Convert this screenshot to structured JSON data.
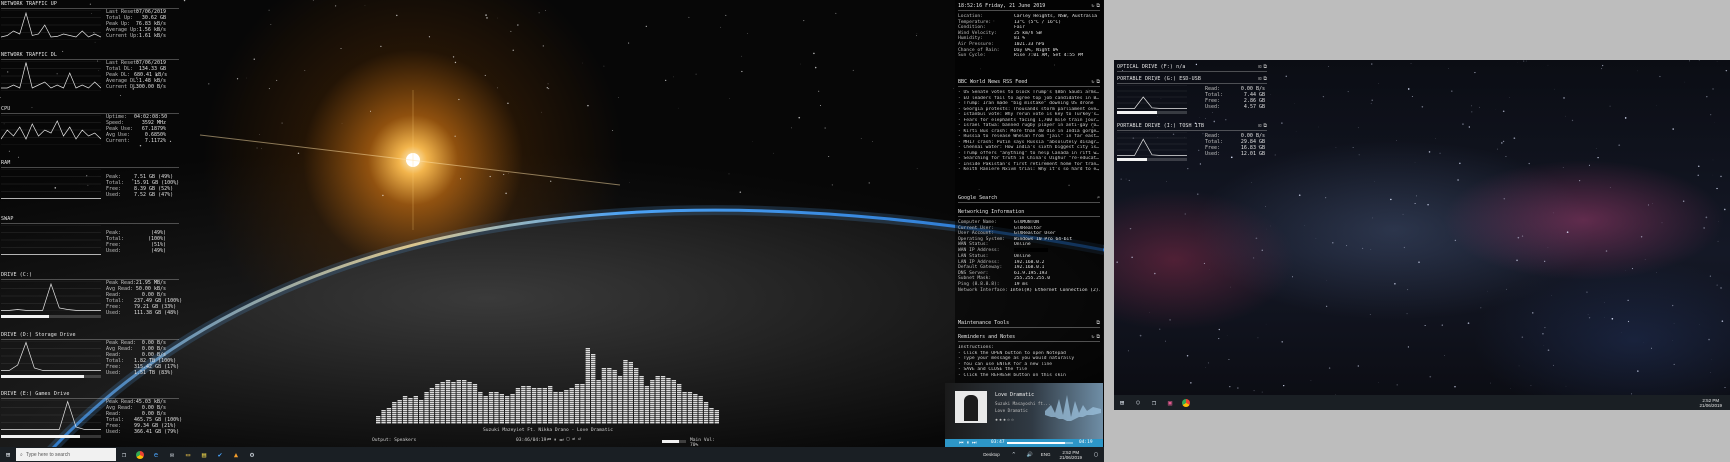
{
  "left_widgets": {
    "net_up": {
      "title": "NETWORK TRAFFIC UP",
      "rows": [
        {
          "label": "Last Reset:",
          "value": "07/06/2019"
        },
        {
          "label": "Total Up:",
          "value": "30.62 GB"
        },
        {
          "label": "Peak Up:",
          "value": "76.83 kB/s"
        },
        {
          "label": "Average Up:",
          "value": "1.56 kB/s"
        },
        {
          "label": "Current Up:",
          "value": "1.61 kB/s"
        }
      ]
    },
    "net_dl": {
      "title": "NETWORK TRAFFIC DL",
      "rows": [
        {
          "label": "Last Reset:",
          "value": "07/06/2019"
        },
        {
          "label": "Total DL:",
          "value": "134.33 GB"
        },
        {
          "label": "Peak DL:",
          "value": "680.41 kB/s"
        },
        {
          "label": "Average DL:",
          "value": "1.48 kB/s"
        },
        {
          "label": "Current DL:",
          "value": "300.00 B/s"
        }
      ]
    },
    "cpu": {
      "title": "CPU",
      "rows": [
        {
          "label": "Uptime:",
          "value": "04:02:08:50"
        },
        {
          "label": "Speed:",
          "value": "3592 MHz"
        },
        {
          "label": "Peak Use:",
          "value": "67.1879%"
        },
        {
          "label": "Avg Use:",
          "value": "0.6850%"
        },
        {
          "label": "Current:",
          "value": "7.1172%"
        }
      ]
    },
    "ram": {
      "title": "RAM",
      "rows": [
        {
          "label": "Peak:",
          "value": "7.51 GB (49%)"
        },
        {
          "label": "Total:",
          "value": "15.91 GB (100%)"
        },
        {
          "label": "Free:",
          "value": "8.39 GB (52%)"
        },
        {
          "label": "Used:",
          "value": "7.52 GB (47%)"
        }
      ]
    },
    "swap": {
      "title": "SWAP",
      "rows": [
        {
          "label": "Peak:",
          "value": "(49%)"
        },
        {
          "label": "Total:",
          "value": "(100%)"
        },
        {
          "label": "Free:",
          "value": "(51%)"
        },
        {
          "label": "Used:",
          "value": "(49%)"
        }
      ]
    },
    "drive_c": {
      "title": "DRIVE (C:)",
      "usage": 0.48,
      "rows": [
        {
          "label": "Peak Read:",
          "value": "21.95 MB/s"
        },
        {
          "label": "Avg Read:",
          "value": "50.00 kB/s"
        },
        {
          "label": "Read:",
          "value": "0.00 B/s"
        },
        {
          "label": "Total:",
          "value": "237.49 GB (100%)"
        },
        {
          "label": "Free:",
          "value": "79.21 GB (33%)"
        },
        {
          "label": "Used:",
          "value": "111.38 GB (48%)"
        }
      ]
    },
    "drive_d": {
      "title": "DRIVE (D:) Storage Drive",
      "usage": 0.83,
      "rows": [
        {
          "label": "Peak Read:",
          "value": "0.00 B/s"
        },
        {
          "label": "Avg Read:",
          "value": "0.00 B/s"
        },
        {
          "label": "Read:",
          "value": "0.00 B/s"
        },
        {
          "label": "Total:",
          "value": "1.82 TB (100%)"
        },
        {
          "label": "Free:",
          "value": "315.42 GB (17%)"
        },
        {
          "label": "Used:",
          "value": "1.51 TB (83%)"
        }
      ]
    },
    "drive_e": {
      "title": "DRIVE (E:) Games Drive",
      "usage": 0.79,
      "rows": [
        {
          "label": "Peak Read:",
          "value": "45.03 kB/s"
        },
        {
          "label": "Avg Read:",
          "value": "0.00 B/s"
        },
        {
          "label": "Read:",
          "value": "0.00 B/s"
        },
        {
          "label": "Total:",
          "value": "465.75 GB (100%)"
        },
        {
          "label": "Free:",
          "value": "99.34 GB (21%)"
        },
        {
          "label": "Used:",
          "value": "366.41 GB (79%)"
        }
      ]
    }
  },
  "info_panel": {
    "clock": "18:52:16 Friday, 21 June 2019",
    "weather": [
      {
        "k": "Location:",
        "v": "Carley Heights, NSW, Australia"
      },
      {
        "k": "Temperature:",
        "v": "13°C (5°C / 16°C)"
      },
      {
        "k": "Condition:",
        "v": "Fair"
      },
      {
        "k": "Wind Velocity:",
        "v": "25 km/h SW"
      },
      {
        "k": "Humidity:",
        "v": "81 %"
      },
      {
        "k": "Air Pressure:",
        "v": "1021.33 hPa"
      },
      {
        "k": "Chance of Rain:",
        "v": "Day 0%, Night 0%"
      },
      {
        "k": "Sun Cycle:",
        "v": "Rise 7:01 AM, Set 4:55 PM"
      }
    ],
    "rss_title": "BBC World News RSS Feed",
    "rss_items": [
      "- US Senate votes to block Trump's $8bn Saudi arms sa...",
      "- EU leaders fail to agree top job candidates in Brus...",
      "- Trump: Iran made \"big mistake\" downing US drone",
      "- Georgia protests: Thousands storm parliament over Ru...",
      "- Istanbul vote: Why rerun vote is key to Turkey's fu...",
      "- Fears for elephants facing 1,700 mile train journey...",
      "- Israel fatwa: banned rugby player in anti-gay row ag...",
      "- Kirti Bus crash: More than 40 die in India gorge cl...",
      "- Russia to release Whelan from \"jail\" in far east st...",
      "- MH17 crash: Putin says Russia \"absolutely disagrees...",
      "- Chennai water: How India's sixth biggest city is ru...",
      "- Trump offers \"anything\" to help Canada in rift with...",
      "- Searching for truth in China's Uighur \"re-education...",
      "- Inside Pakistan's first retirement home for transge...",
      "- Keith Raniere Nxivm trial: Why it's so hard to escap..."
    ],
    "search_title": "Google Search",
    "network_title": "Networking Information",
    "network": [
      {
        "k": "Computer Name:",
        "v": "GTXMONTON"
      },
      {
        "k": "Current User:",
        "v": "GTXRealtor"
      },
      {
        "k": "User Account:",
        "v": "GTXRealtor User"
      },
      {
        "k": "Operating System:",
        "v": "Windows 10 Pro 64-bit"
      },
      {
        "k": "WAN Status:",
        "v": "Online"
      },
      {
        "k": "WAN IP Address:",
        "v": ""
      },
      {
        "k": "LAN Status:",
        "v": "Online"
      },
      {
        "k": "LAN IP Address:",
        "v": "192.168.0.2"
      },
      {
        "k": "Default Gateway:",
        "v": "192.168.0.1"
      },
      {
        "k": "DNS Server:",
        "v": "61.9.195.193"
      },
      {
        "k": "Subnet Mask:",
        "v": "255.255.255.0"
      },
      {
        "k": "Ping (8.8.8.8):",
        "v": "19 ms"
      },
      {
        "k": "Network Interface:",
        "v": "Intel(R) Ethernet Connection (2)..."
      }
    ],
    "maintenance_title": "Maintenance Tools",
    "reminders_title": "Reminders and Notes",
    "notes": [
      "Instructions:",
      "- Click the OPEN button to open Notepad",
      "- Type your message as you would naturally",
      "- You can use ENTER for a new line",
      "- SAVE and CLOSE the file",
      "- Click the REFRESH button on this skin"
    ]
  },
  "visualizer": {
    "track": "Suzuki Mazeyiet Ft. Nikka Drano - Love Dramatic",
    "output": "Output: Speakers",
    "time": "03:46/04:19",
    "volume": "Main Vol: 70%",
    "volume_level": 0.7,
    "levels": [
      0.12,
      0.18,
      0.22,
      0.28,
      0.3,
      0.35,
      0.34,
      0.36,
      0.3,
      0.42,
      0.46,
      0.52,
      0.54,
      0.55,
      0.54,
      0.55,
      0.55,
      0.54,
      0.5,
      0.4,
      0.36,
      0.4,
      0.42,
      0.38,
      0.35,
      0.38,
      0.45,
      0.48,
      0.48,
      0.47,
      0.46,
      0.46,
      0.48,
      0.42,
      0.4,
      0.44,
      0.46,
      0.5,
      0.52,
      0.95,
      0.88,
      0.55,
      0.72,
      0.7,
      0.68,
      0.62,
      0.8,
      0.78,
      0.7,
      0.62,
      0.48,
      0.55,
      0.62,
      0.6,
      0.58,
      0.55,
      0.52,
      0.42,
      0.4,
      0.38,
      0.36,
      0.28,
      0.22,
      0.18
    ]
  },
  "media": {
    "title": "Love Dramatic",
    "artist": "Suzuki Masayoshi ft...",
    "album": "Love Dramatic",
    "elapsed": "03:47",
    "total": "04:19",
    "progress": 0.876
  },
  "right_monitor": {
    "drives": [
      {
        "title": "OPTICAL DRIVE (F:) n/a",
        "rows": []
      },
      {
        "title": "PORTABLE DRIVE (G:) ESD-USB",
        "usage": 0.57,
        "rows": [
          {
            "label": "Read:",
            "value": "0.00 B/s"
          },
          {
            "label": "Total:",
            "value": "7.44 GB"
          },
          {
            "label": "Free:",
            "value": "2.86 GB"
          },
          {
            "label": "Used:",
            "value": "4.57 GB"
          }
        ]
      },
      {
        "title": "PORTABLE DRIVE (I:) TOSH 1TB",
        "usage": 0.43,
        "rows": [
          {
            "label": "Read:",
            "value": "0.00 B/s"
          },
          {
            "label": "Total:",
            "value": "29.84 GB"
          },
          {
            "label": "Free:",
            "value": "16.83 GB"
          },
          {
            "label": "Used:",
            "value": "12.01 GB"
          }
        ]
      }
    ],
    "clock_time": "2:52 PM",
    "clock_date": "21/06/2019"
  },
  "taskbar": {
    "search_placeholder": "Type here to search",
    "tray_desktop": "Desktop",
    "tray_lang": "ENG",
    "clock_time": "2:52 PM",
    "clock_date": "21/06/2019"
  }
}
